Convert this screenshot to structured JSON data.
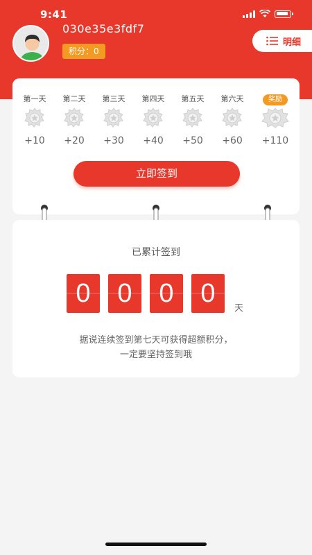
{
  "status_bar": {
    "time": "9:41"
  },
  "user": {
    "name": "030e35e3fdf7",
    "points_label": "积分：0"
  },
  "detail_button": {
    "label": "明细",
    "icon": "list-icon"
  },
  "checkin": {
    "days": [
      {
        "label": "第一天",
        "points": "+10"
      },
      {
        "label": "第二天",
        "points": "+20"
      },
      {
        "label": "第三天",
        "points": "+30"
      },
      {
        "label": "第四天",
        "points": "+40"
      },
      {
        "label": "第五天",
        "points": "+50"
      },
      {
        "label": "第六天",
        "points": "+60"
      },
      {
        "label": "奖励",
        "points": "+110"
      }
    ],
    "button_label": "立即签到"
  },
  "cumulative": {
    "label": "已累计签到",
    "digits": [
      "0",
      "0",
      "0",
      "0"
    ],
    "unit": "天",
    "tip_line1": "据说连续签到第七天可获得超额积分，",
    "tip_line2": "一定要坚持签到哦"
  },
  "colors": {
    "primary": "#e8382c",
    "accent": "#f39a23"
  }
}
